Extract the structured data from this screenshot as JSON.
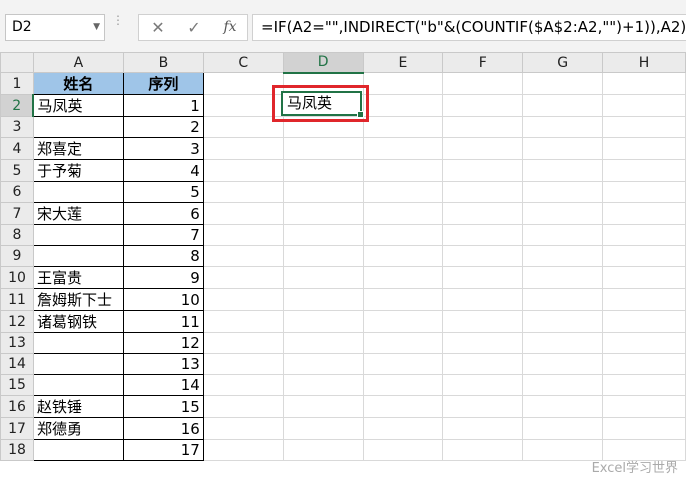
{
  "namebox": "D2",
  "formula_buttons": {
    "cancel": "✕",
    "enter": "✓",
    "fx": "fx"
  },
  "formula": "=IF(A2=\"\",INDIRECT(\"b\"&(COUNTIF($A$2:A2,\"\")+1)),A2)",
  "columns": [
    "A",
    "B",
    "C",
    "D",
    "E",
    "F",
    "G",
    "H"
  ],
  "headers": {
    "a": "姓名",
    "b": "序列"
  },
  "rows": [
    {
      "n": "1"
    },
    {
      "n": "2",
      "a": "马凤英",
      "b": "1"
    },
    {
      "n": "3",
      "a": "",
      "b": "2"
    },
    {
      "n": "4",
      "a": "郑喜定",
      "b": "3"
    },
    {
      "n": "5",
      "a": "于予菊",
      "b": "4"
    },
    {
      "n": "6",
      "a": "",
      "b": "5"
    },
    {
      "n": "7",
      "a": "宋大莲",
      "b": "6"
    },
    {
      "n": "8",
      "a": "",
      "b": "7"
    },
    {
      "n": "9",
      "a": "",
      "b": "8"
    },
    {
      "n": "10",
      "a": "王富贵",
      "b": "9"
    },
    {
      "n": "11",
      "a": "詹姆斯下士",
      "b": "10"
    },
    {
      "n": "12",
      "a": "诸葛钢铁",
      "b": "11"
    },
    {
      "n": "13",
      "a": "",
      "b": "12"
    },
    {
      "n": "14",
      "a": "",
      "b": "13"
    },
    {
      "n": "15",
      "a": "",
      "b": "14"
    },
    {
      "n": "16",
      "a": "赵铁锤",
      "b": "15"
    },
    {
      "n": "17",
      "a": "郑德勇",
      "b": "16"
    },
    {
      "n": "18",
      "a": "",
      "b": "17"
    }
  ],
  "active_cell_value": "马凤英",
  "watermark": "Excel学习世界",
  "colors": {
    "selection": "#217346",
    "highlight": "#e0262b",
    "header_fill": "#9fc5e8"
  }
}
